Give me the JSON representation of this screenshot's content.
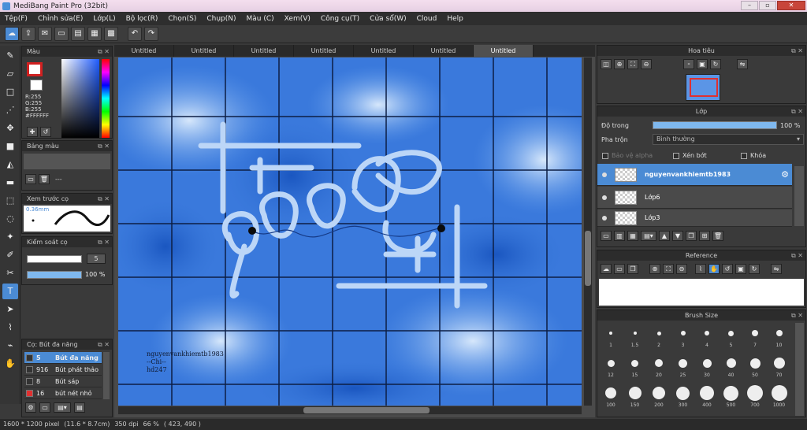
{
  "title": "MediBang Paint Pro (32bit)",
  "menu": [
    "Tệp(F)",
    "Chỉnh sửa(E)",
    "Lớp(L)",
    "Bộ lọc(R)",
    "Chọn(S)",
    "Chụp(N)",
    "Màu (C)",
    "Xem(V)",
    "Công cụ(T)",
    "Cửa sổ(W)",
    "Cloud",
    "Help"
  ],
  "color_panel": {
    "title": "Màu",
    "r": "R:255",
    "g": "G:255",
    "b": "B:255",
    "hex": "#FFFFFF"
  },
  "palette_panel": {
    "title": "Bảng màu",
    "dash": "---"
  },
  "preview_panel": {
    "title": "Xem trước cọ",
    "size": "0.36mm"
  },
  "brush_control": {
    "title": "Kiểm soát cọ",
    "size": "5",
    "opacity": "100 %",
    "opacity_value": 1.0
  },
  "brush_list": {
    "title": "Cọ: Bút đa năng",
    "items": [
      {
        "size": "5",
        "name": "Bút đa năng",
        "color": "#333333"
      },
      {
        "size": "916",
        "name": "Bút phát thảo",
        "color": "#333333"
      },
      {
        "size": "8",
        "name": "Bút sáp",
        "color": "#333333"
      },
      {
        "size": "16",
        "name": "bút nét nhỏ",
        "color": "#e03030"
      }
    ]
  },
  "tabs": [
    "Untitled",
    "Untitled",
    "Untitled",
    "Untitled",
    "Untitled",
    "Untitled",
    "Untitled"
  ],
  "canvas_text": [
    "nguyenvankhiemtb1983",
    "--Chi--",
    "hd247"
  ],
  "navigator": {
    "title": "Hoa tiêu"
  },
  "layer_panel": {
    "title": "Lớp",
    "opacity_label": "Độ trong",
    "opacity_value": "100 %",
    "opacity_fraction": 1.0,
    "blend_label": "Pha trộn",
    "blend_value": "Bình thường",
    "protect_alpha": "Bảo vệ alpha",
    "clipping": "Xén bớt",
    "lock": "Khóa",
    "layers": [
      "nguyenvankhiemtb1983",
      "Lớp6",
      "Lớp3"
    ]
  },
  "reference": {
    "title": "Reference"
  },
  "brush_size": {
    "title": "Brush Size",
    "sizes": [
      "1",
      "1.5",
      "2",
      "3",
      "4",
      "5",
      "7",
      "10",
      "12",
      "15",
      "20",
      "25",
      "30",
      "40",
      "50",
      "70",
      "100",
      "150",
      "200",
      "300",
      "400",
      "500",
      "700",
      "1000"
    ]
  },
  "status": {
    "dims": "1600 * 1200 pixel",
    "cm": "(11.6 * 8.7cm)",
    "dpi": "350 dpi",
    "zoom": "66 %",
    "coords": "( 423, 490 )"
  }
}
